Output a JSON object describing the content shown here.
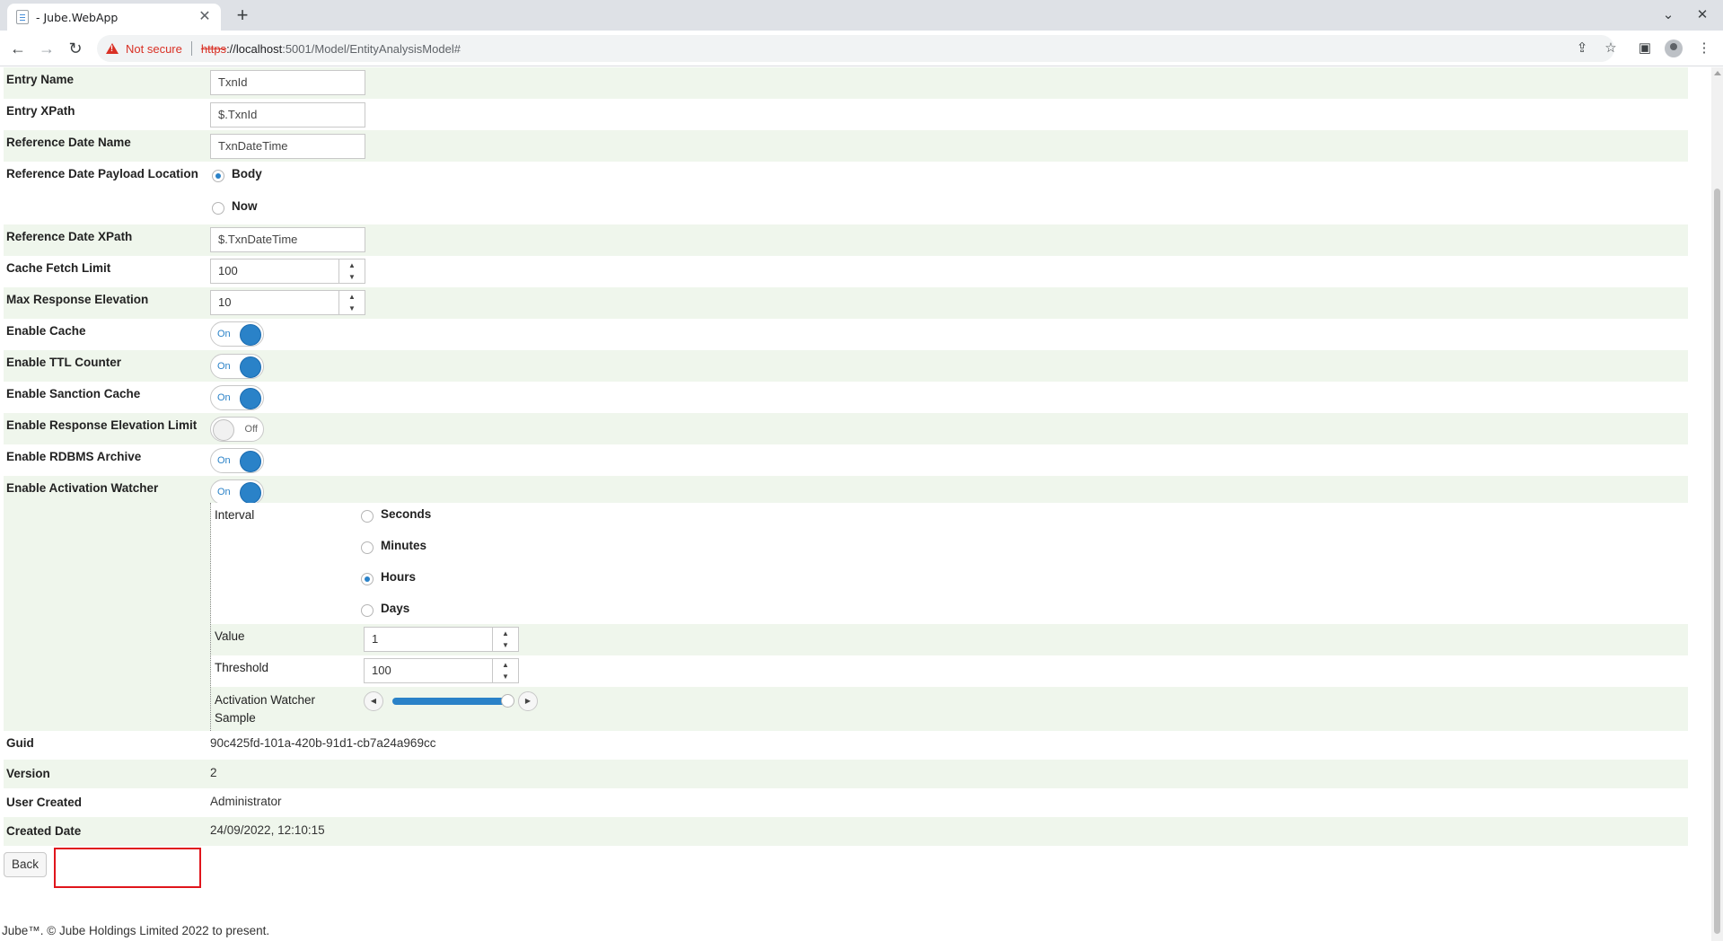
{
  "browser": {
    "tab_title": "- Jube.WebApp",
    "tab_close": "✕",
    "new_tab": "+",
    "not_secure": "Not secure",
    "url_scheme": "https",
    "url_host": "://localhost",
    "url_path": ":5001/Model/EntityAnalysisModel#"
  },
  "form": {
    "entry_name": {
      "label": "Entry Name",
      "value": "TxnId"
    },
    "entry_xpath": {
      "label": "Entry XPath",
      "value": "$.TxnId"
    },
    "reference_date_name": {
      "label": "Reference Date Name",
      "value": "TxnDateTime"
    },
    "reference_date_payload_location": {
      "label": "Reference Date Payload Location",
      "options": [
        "Body",
        "Now"
      ],
      "selected": "Body"
    },
    "reference_date_xpath": {
      "label": "Reference Date XPath",
      "value": "$.TxnDateTime"
    },
    "cache_fetch_limit": {
      "label": "Cache Fetch Limit",
      "value": "100"
    },
    "max_response_elevation": {
      "label": "Max Response Elevation",
      "value": "10"
    },
    "enable_cache": {
      "label": "Enable Cache",
      "state": "On"
    },
    "enable_ttl_counter": {
      "label": "Enable TTL Counter",
      "state": "On"
    },
    "enable_sanction_cache": {
      "label": "Enable Sanction Cache",
      "state": "On"
    },
    "enable_response_elevation_limit": {
      "label": "Enable Response Elevation Limit",
      "state": "Off"
    },
    "enable_rdbms_archive": {
      "label": "Enable RDBMS Archive",
      "state": "On"
    },
    "enable_activation_watcher": {
      "label": "Enable Activation Watcher",
      "state": "On"
    },
    "activation_watcher": {
      "interval": {
        "label": "Interval",
        "options": [
          "Seconds",
          "Minutes",
          "Hours",
          "Days"
        ],
        "selected": "Hours"
      },
      "value": {
        "label": "Value",
        "value": "1"
      },
      "threshold": {
        "label": "Threshold",
        "value": "100"
      },
      "sample": {
        "label_line1": "Activation Watcher",
        "label_line2": "Sample",
        "level": 1.0
      }
    },
    "guid": {
      "label": "Guid",
      "value": "90c425fd-101a-420b-91d1-cb7a24a969cc"
    },
    "version": {
      "label": "Version",
      "value": "2"
    },
    "user_created": {
      "label": "User Created",
      "value": "Administrator"
    },
    "created_date": {
      "label": "Created Date",
      "value": "24/09/2022, 12:10:15"
    }
  },
  "actions": {
    "back_label": "Back"
  },
  "footer": {
    "text": "Jube™. © Jube Holdings Limited 2022 to present."
  }
}
